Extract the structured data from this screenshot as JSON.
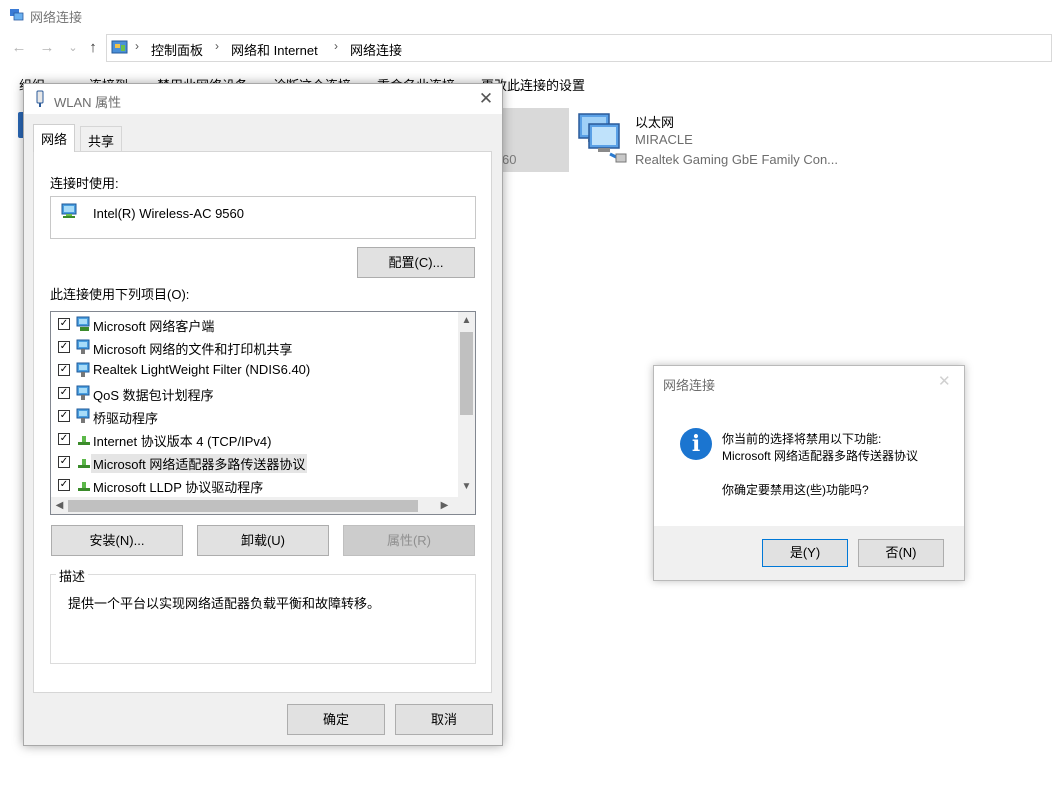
{
  "window": {
    "title": "网络连接"
  },
  "nav": {
    "back": "←",
    "forward": "→",
    "recent": "⌄",
    "up": "↑"
  },
  "address": {
    "crumbs": [
      "控制面板",
      "网络和 Internet",
      "网络连接"
    ],
    "separator": "›"
  },
  "commands": [
    "组织 ▾",
    "连接到",
    "禁用此网络设备",
    "诊断这个连接",
    "重命名此连接",
    "更改此连接的设置"
  ],
  "connections": {
    "selected_partial_text": "60",
    "ethernet": {
      "name": "以太网",
      "status": "MIRACLE",
      "device": "Realtek Gaming GbE Family Con..."
    }
  },
  "wlan_dialog": {
    "title": "WLAN 属性",
    "close": "✕",
    "tabs": [
      "网络",
      "共享"
    ],
    "connect_using_label": "连接时使用:",
    "adapter_name": "Intel(R) Wireless-AC 9560",
    "configure_button": "配置(C)...",
    "items_label": "此连接使用下列项目(O):",
    "items": [
      {
        "label": "Microsoft 网络客户端",
        "checked": true,
        "icon": "network-client-icon"
      },
      {
        "label": "Microsoft 网络的文件和打印机共享",
        "checked": true,
        "icon": "network-service-icon"
      },
      {
        "label": "Realtek LightWeight Filter (NDIS6.40)",
        "checked": true,
        "icon": "network-service-icon"
      },
      {
        "label": "QoS 数据包计划程序",
        "checked": true,
        "icon": "network-service-icon"
      },
      {
        "label": "桥驱动程序",
        "checked": true,
        "icon": "network-service-icon"
      },
      {
        "label": "Internet 协议版本 4 (TCP/IPv4)",
        "checked": true,
        "icon": "protocol-icon"
      },
      {
        "label": "Microsoft 网络适配器多路传送器协议",
        "checked": true,
        "icon": "protocol-icon"
      },
      {
        "label": "Microsoft LLDP 协议驱动程序",
        "checked": true,
        "icon": "protocol-icon"
      }
    ],
    "install_button": "安装(N)...",
    "uninstall_button": "卸载(U)",
    "properties_button": "属性(R)",
    "description_label": "描述",
    "description_text": "提供一个平台以实现网络适配器负载平衡和故障转移。",
    "ok_button": "确定",
    "cancel_button": "取消"
  },
  "confirm_dialog": {
    "title": "网络连接",
    "close": "✕",
    "icon": "info-icon",
    "icon_glyph": "i",
    "line1": "你当前的选择将禁用以下功能:",
    "line2": "Microsoft 网络适配器多路传送器协议",
    "question": "你确定要禁用这(些)功能吗?",
    "yes_button": "是(Y)",
    "no_button": "否(N)"
  },
  "colors": {
    "accent": "#0078d7",
    "info": "#1b75d0",
    "dialog_bg": "#f0f0f0"
  }
}
